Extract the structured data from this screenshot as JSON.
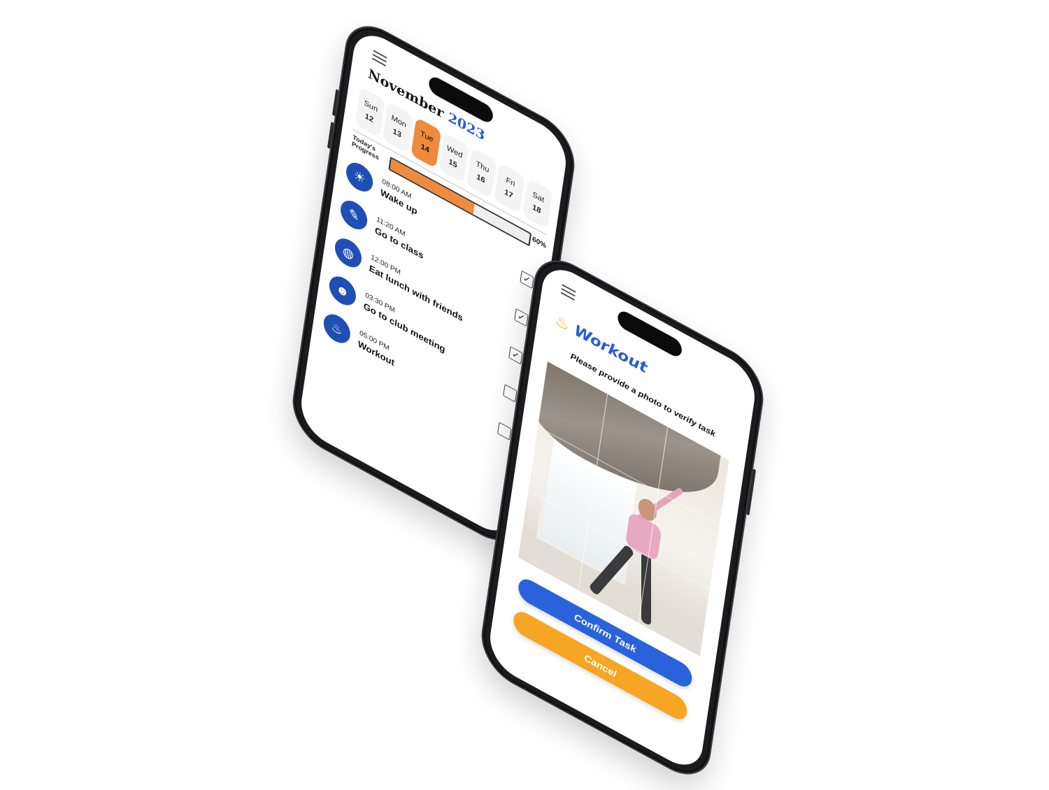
{
  "calendar_screen": {
    "month": "November",
    "year": "2023",
    "days": [
      {
        "name": "Sun",
        "num": "12"
      },
      {
        "name": "Mon",
        "num": "13"
      },
      {
        "name": "Tue",
        "num": "14"
      },
      {
        "name": "Wed",
        "num": "15"
      },
      {
        "name": "Thu",
        "num": "16"
      },
      {
        "name": "Fri",
        "num": "17"
      },
      {
        "name": "Sat",
        "num": "18"
      }
    ],
    "active_day_index": 2,
    "progress_label": "Today's Progress",
    "progress_value": 0.6,
    "progress_text": "60%",
    "tasks": [
      {
        "time": "08:00 AM",
        "name": "Wake up",
        "icon": "sun-icon",
        "glyph": "☀",
        "checked": true
      },
      {
        "time": "11:20 AM",
        "name": "Go to class",
        "icon": "study-icon",
        "glyph": "✎",
        "checked": true
      },
      {
        "time": "12:00 PM",
        "name": "Eat lunch with friends",
        "icon": "globe-icon",
        "glyph": "◍",
        "checked": true
      },
      {
        "time": "03:30 PM",
        "name": "Go to club meeting",
        "icon": "group-icon",
        "glyph": "☻",
        "checked": false
      },
      {
        "time": "05:00 PM",
        "name": "Workout",
        "icon": "flame-icon",
        "glyph": "♨",
        "checked": false
      }
    ],
    "accent": "#1f4fb4",
    "highlight": "#f08a3c"
  },
  "verify_screen": {
    "title": "Workout",
    "title_icon": "flame-icon",
    "instruction": "Please provide a photo to verify task",
    "confirm_label": "Confirm Task",
    "cancel_label": "Cancel",
    "confirm_color": "#2a62dc",
    "cancel_color": "#f6a623"
  }
}
